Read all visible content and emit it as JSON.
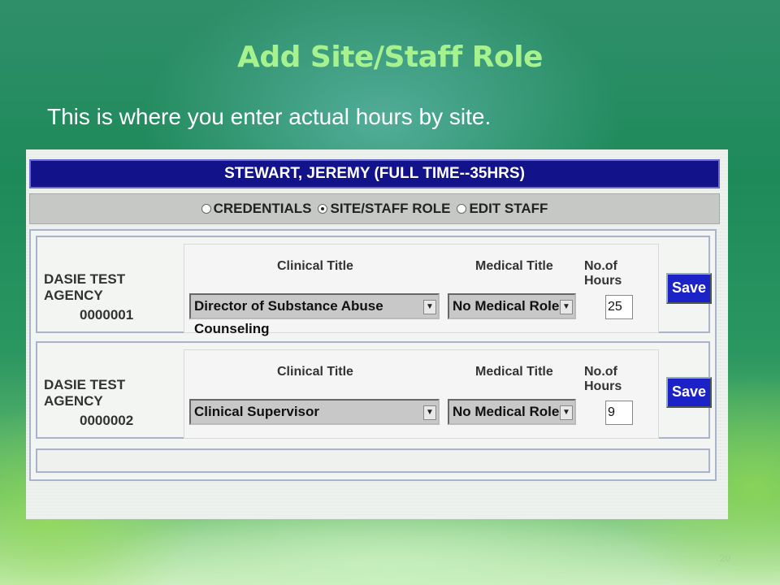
{
  "slide": {
    "title": "Add Site/Staff Role",
    "subtitle": "This is where you enter actual hours by site.",
    "page_number": "20"
  },
  "staff_header": {
    "name": "STEWART, JEREMY (FULL TIME--35HRS)",
    "color": "#12128a"
  },
  "tabs": [
    {
      "label": "CREDENTIALS",
      "selected": false
    },
    {
      "label": "SITE/STAFF ROLE",
      "selected": true
    },
    {
      "label": "EDIT STAFF",
      "selected": false
    }
  ],
  "columns": {
    "clinical_title": "Clinical Title",
    "medical_title": "Medical Title",
    "hours": "No.of Hours"
  },
  "sites": [
    {
      "agency": "DASIE TEST AGENCY",
      "code": "0000001",
      "clinical_title": "Director of Substance Abuse Counseling",
      "medical_title": "No Medical Role",
      "hours": "25",
      "save_label": "Save"
    },
    {
      "agency": "DASIE TEST AGENCY",
      "code": "0000002",
      "clinical_title": "Clinical Supervisor",
      "medical_title": "No Medical Role",
      "hours": "9",
      "save_label": "Save"
    }
  ],
  "colors": {
    "title_text": "#a6f28e",
    "save_button": "#1a22c8"
  }
}
